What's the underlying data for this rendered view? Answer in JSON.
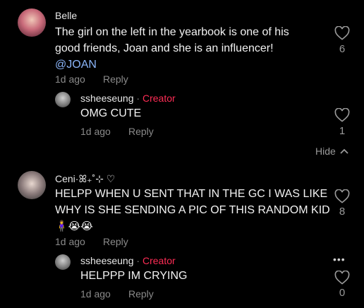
{
  "comments": [
    {
      "author": "Belle",
      "text": "The girl on the left in the yearbook is one of his good friends, Joan and she is an influencer!",
      "mention": "@JOAN",
      "time": "1d ago",
      "reply_label": "Reply",
      "likes": "6",
      "reply": {
        "author": "ssheeseung",
        "separator": " · ",
        "badge": "Creator",
        "text": "OMG CUTE",
        "time": "1d ago",
        "reply_label": "Reply",
        "likes": "1"
      }
    },
    {
      "author": "Ceni·ꕤ₊˚⊹ ♡",
      "text_line1": "HELPP WHEN U SENT THAT IN THE GC I WAS LIKE",
      "text_line2": "WHY IS SHE SENDING A PIC OF THIS RANDOM KID",
      "emojis": "🧍‍♀️😭😭",
      "time": "1d ago",
      "reply_label": "Reply",
      "likes": "8",
      "reply": {
        "author": "ssheeseung",
        "separator": " · ",
        "badge": "Creator",
        "text": "HELPPP IM CRYING",
        "time": "1d ago",
        "reply_label": "Reply",
        "likes": "0"
      }
    }
  ],
  "hide_label": "Hide",
  "more_label": "•••",
  "colors": {
    "background": "#000000",
    "creator": "#fe2c55",
    "mention": "#8ab4f8",
    "muted": "#8a8a8a"
  },
  "icons": {
    "like": "heart-icon",
    "hide": "chevron-up-icon",
    "more": "more-dots-icon"
  }
}
